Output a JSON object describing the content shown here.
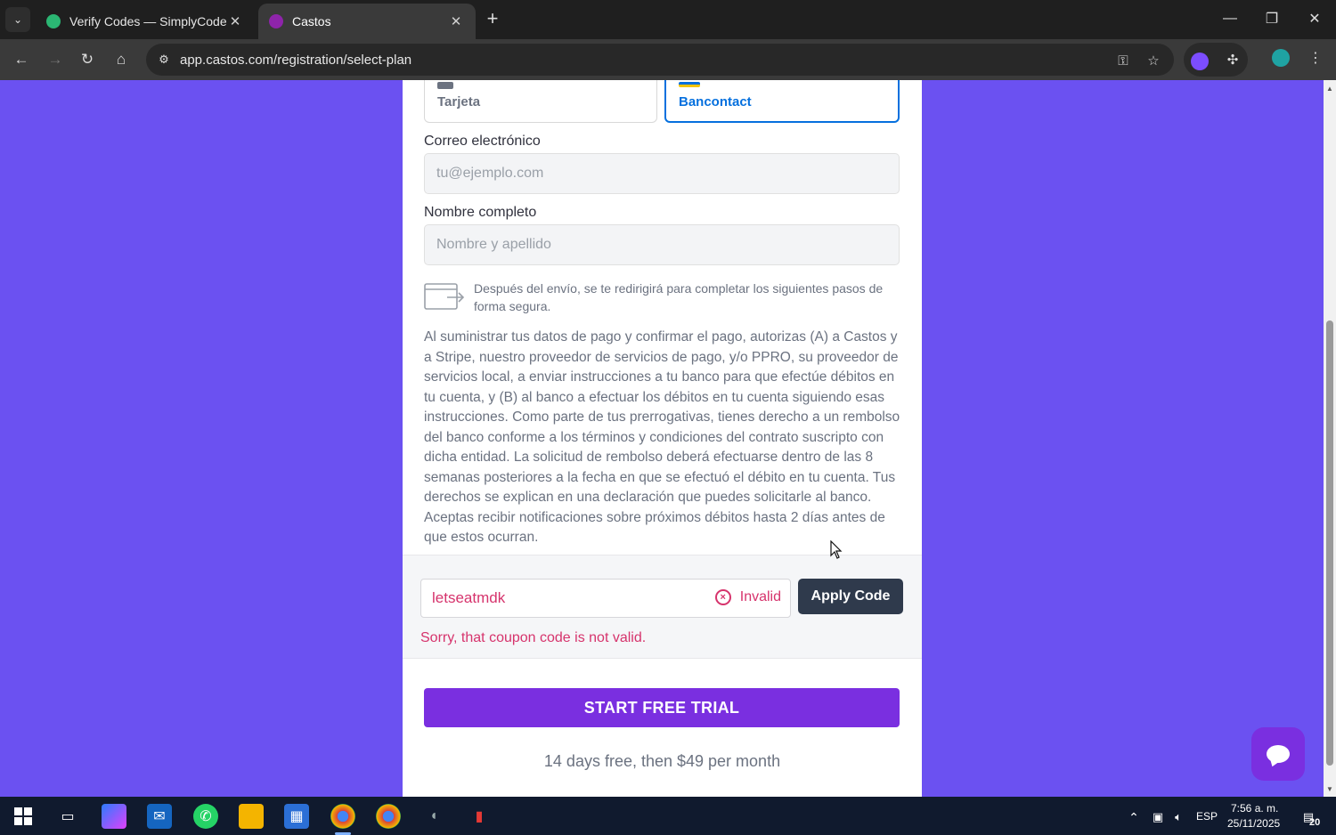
{
  "browser": {
    "tabs": [
      {
        "title": "Verify Codes — SimplyCodes",
        "active": false,
        "favicon": "simplycodes-green-icon"
      },
      {
        "title": "Castos",
        "active": true,
        "favicon": "castos-purple-icon"
      }
    ],
    "url": "app.castos.com/registration/select-plan",
    "new_tab_glyph": "+",
    "close_glyph": "✕",
    "menu_glyph": "⌄"
  },
  "payment_methods": [
    {
      "label": "Tarjeta",
      "selected": false
    },
    {
      "label": "Bancontact",
      "selected": true
    }
  ],
  "form": {
    "email_label": "Correo electrónico",
    "email_placeholder": "tu@ejemplo.com",
    "name_label": "Nombre completo",
    "name_placeholder": "Nombre y apellido",
    "redirect_note": "Después del envío, se te redirigirá para completar los siguientes pasos de forma segura.",
    "mandate_text": "Al suministrar tus datos de pago y confirmar el pago, autorizas (A) a Castos y a Stripe, nuestro proveedor de servicios de pago, y/o PPRO, su proveedor de servicios local, a enviar instrucciones a tu banco para que efectúe débitos en tu cuenta, y (B) al banco a efectuar los débitos en tu cuenta siguiendo esas instrucciones. Como parte de tus prerrogativas, tienes derecho a un rembolso del banco conforme a los términos y condiciones del contrato suscripto con dicha entidad. La solicitud de rembolso deberá efectuarse dentro de las 8 semanas posteriores a la fecha en que se efectuó el débito en tu cuenta. Tus derechos se explican en una declaración que puedes solicitarle al banco. Aceptas recibir notificaciones sobre próximos débitos hasta 2 días antes de que estos ocurran."
  },
  "coupon": {
    "value": "letseatmdk",
    "status": "Invalid",
    "apply_label": "Apply Code",
    "error": "Sorry, that coupon code is not valid.",
    "error_color": "#d6336c"
  },
  "cta": {
    "label": "START FREE TRIAL",
    "note": "14 days free, then $49 per month",
    "color": "#7a2fe0"
  },
  "taskbar": {
    "language": "ESP",
    "time": "7:56 a. m.",
    "date": "25/11/2025",
    "notifications": "20"
  }
}
